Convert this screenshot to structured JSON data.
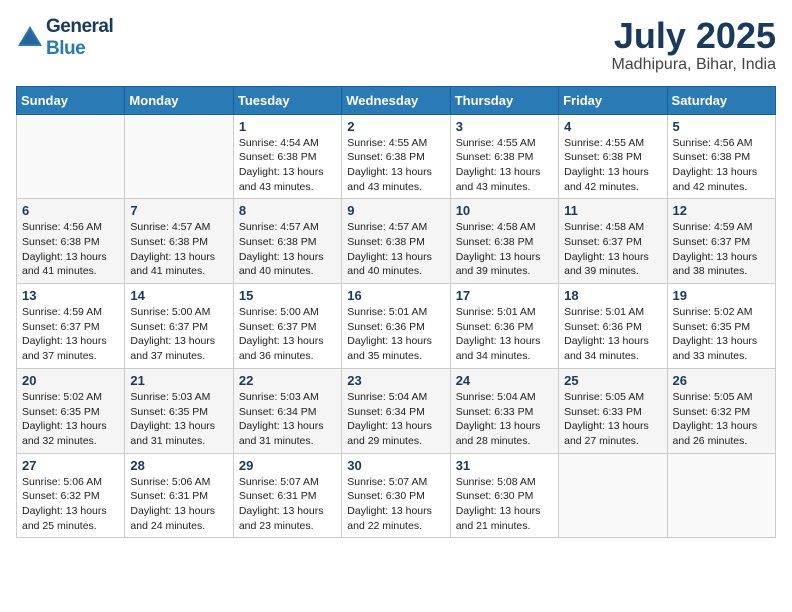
{
  "header": {
    "logo_line1": "General",
    "logo_line2": "Blue",
    "month_title": "July 2025",
    "location": "Madhipura, Bihar, India"
  },
  "days_of_week": [
    "Sunday",
    "Monday",
    "Tuesday",
    "Wednesday",
    "Thursday",
    "Friday",
    "Saturday"
  ],
  "weeks": [
    [
      {
        "day": "",
        "info": ""
      },
      {
        "day": "",
        "info": ""
      },
      {
        "day": "1",
        "info": "Sunrise: 4:54 AM\nSunset: 6:38 PM\nDaylight: 13 hours\nand 43 minutes."
      },
      {
        "day": "2",
        "info": "Sunrise: 4:55 AM\nSunset: 6:38 PM\nDaylight: 13 hours\nand 43 minutes."
      },
      {
        "day": "3",
        "info": "Sunrise: 4:55 AM\nSunset: 6:38 PM\nDaylight: 13 hours\nand 43 minutes."
      },
      {
        "day": "4",
        "info": "Sunrise: 4:55 AM\nSunset: 6:38 PM\nDaylight: 13 hours\nand 42 minutes."
      },
      {
        "day": "5",
        "info": "Sunrise: 4:56 AM\nSunset: 6:38 PM\nDaylight: 13 hours\nand 42 minutes."
      }
    ],
    [
      {
        "day": "6",
        "info": "Sunrise: 4:56 AM\nSunset: 6:38 PM\nDaylight: 13 hours\nand 41 minutes."
      },
      {
        "day": "7",
        "info": "Sunrise: 4:57 AM\nSunset: 6:38 PM\nDaylight: 13 hours\nand 41 minutes."
      },
      {
        "day": "8",
        "info": "Sunrise: 4:57 AM\nSunset: 6:38 PM\nDaylight: 13 hours\nand 40 minutes."
      },
      {
        "day": "9",
        "info": "Sunrise: 4:57 AM\nSunset: 6:38 PM\nDaylight: 13 hours\nand 40 minutes."
      },
      {
        "day": "10",
        "info": "Sunrise: 4:58 AM\nSunset: 6:38 PM\nDaylight: 13 hours\nand 39 minutes."
      },
      {
        "day": "11",
        "info": "Sunrise: 4:58 AM\nSunset: 6:37 PM\nDaylight: 13 hours\nand 39 minutes."
      },
      {
        "day": "12",
        "info": "Sunrise: 4:59 AM\nSunset: 6:37 PM\nDaylight: 13 hours\nand 38 minutes."
      }
    ],
    [
      {
        "day": "13",
        "info": "Sunrise: 4:59 AM\nSunset: 6:37 PM\nDaylight: 13 hours\nand 37 minutes."
      },
      {
        "day": "14",
        "info": "Sunrise: 5:00 AM\nSunset: 6:37 PM\nDaylight: 13 hours\nand 37 minutes."
      },
      {
        "day": "15",
        "info": "Sunrise: 5:00 AM\nSunset: 6:37 PM\nDaylight: 13 hours\nand 36 minutes."
      },
      {
        "day": "16",
        "info": "Sunrise: 5:01 AM\nSunset: 6:36 PM\nDaylight: 13 hours\nand 35 minutes."
      },
      {
        "day": "17",
        "info": "Sunrise: 5:01 AM\nSunset: 6:36 PM\nDaylight: 13 hours\nand 34 minutes."
      },
      {
        "day": "18",
        "info": "Sunrise: 5:01 AM\nSunset: 6:36 PM\nDaylight: 13 hours\nand 34 minutes."
      },
      {
        "day": "19",
        "info": "Sunrise: 5:02 AM\nSunset: 6:35 PM\nDaylight: 13 hours\nand 33 minutes."
      }
    ],
    [
      {
        "day": "20",
        "info": "Sunrise: 5:02 AM\nSunset: 6:35 PM\nDaylight: 13 hours\nand 32 minutes."
      },
      {
        "day": "21",
        "info": "Sunrise: 5:03 AM\nSunset: 6:35 PM\nDaylight: 13 hours\nand 31 minutes."
      },
      {
        "day": "22",
        "info": "Sunrise: 5:03 AM\nSunset: 6:34 PM\nDaylight: 13 hours\nand 31 minutes."
      },
      {
        "day": "23",
        "info": "Sunrise: 5:04 AM\nSunset: 6:34 PM\nDaylight: 13 hours\nand 29 minutes."
      },
      {
        "day": "24",
        "info": "Sunrise: 5:04 AM\nSunset: 6:33 PM\nDaylight: 13 hours\nand 28 minutes."
      },
      {
        "day": "25",
        "info": "Sunrise: 5:05 AM\nSunset: 6:33 PM\nDaylight: 13 hours\nand 27 minutes."
      },
      {
        "day": "26",
        "info": "Sunrise: 5:05 AM\nSunset: 6:32 PM\nDaylight: 13 hours\nand 26 minutes."
      }
    ],
    [
      {
        "day": "27",
        "info": "Sunrise: 5:06 AM\nSunset: 6:32 PM\nDaylight: 13 hours\nand 25 minutes."
      },
      {
        "day": "28",
        "info": "Sunrise: 5:06 AM\nSunset: 6:31 PM\nDaylight: 13 hours\nand 24 minutes."
      },
      {
        "day": "29",
        "info": "Sunrise: 5:07 AM\nSunset: 6:31 PM\nDaylight: 13 hours\nand 23 minutes."
      },
      {
        "day": "30",
        "info": "Sunrise: 5:07 AM\nSunset: 6:30 PM\nDaylight: 13 hours\nand 22 minutes."
      },
      {
        "day": "31",
        "info": "Sunrise: 5:08 AM\nSunset: 6:30 PM\nDaylight: 13 hours\nand 21 minutes."
      },
      {
        "day": "",
        "info": ""
      },
      {
        "day": "",
        "info": ""
      }
    ]
  ]
}
